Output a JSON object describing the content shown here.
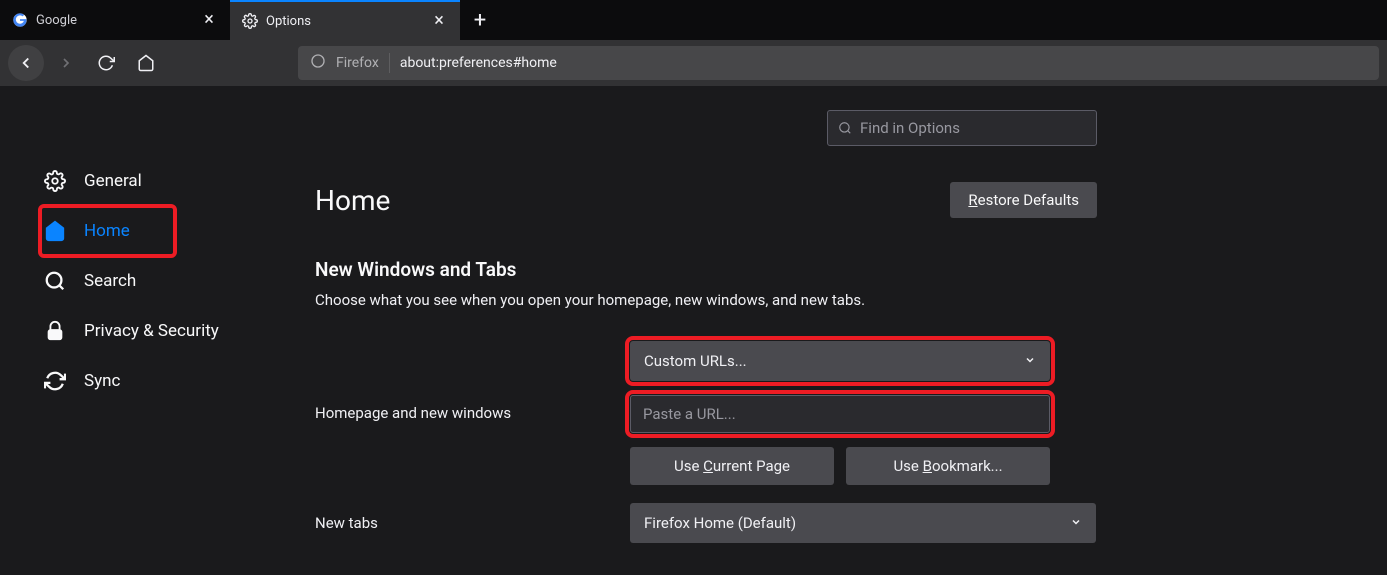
{
  "tabs": [
    {
      "label": "Google"
    },
    {
      "label": "Options"
    }
  ],
  "urlbar": {
    "identity": "Firefox",
    "url": "about:preferences#home"
  },
  "search": {
    "placeholder": "Find in Options"
  },
  "sidebar": {
    "items": [
      {
        "label": "General"
      },
      {
        "label": "Home"
      },
      {
        "label": "Search"
      },
      {
        "label": "Privacy & Security"
      },
      {
        "label": "Sync"
      }
    ]
  },
  "panel": {
    "title": "Home",
    "restore_label": "estore Defaults",
    "restore_accel": "R",
    "section_title": "New Windows and Tabs",
    "section_desc": "Choose what you see when you open your homepage, new windows, and new tabs."
  },
  "settings": {
    "homepage_label": "Homepage and new windows",
    "homepage_dropdown": "Custom URLs...",
    "url_placeholder": "Paste a URL...",
    "use_current_pre": "Use ",
    "use_current_accel": "C",
    "use_current_post": "urrent Page",
    "use_bookmark_pre": "Use ",
    "use_bookmark_accel": "B",
    "use_bookmark_post": "ookmark...",
    "newtabs_label": "New tabs",
    "newtabs_dropdown": "Firefox Home (Default)"
  }
}
